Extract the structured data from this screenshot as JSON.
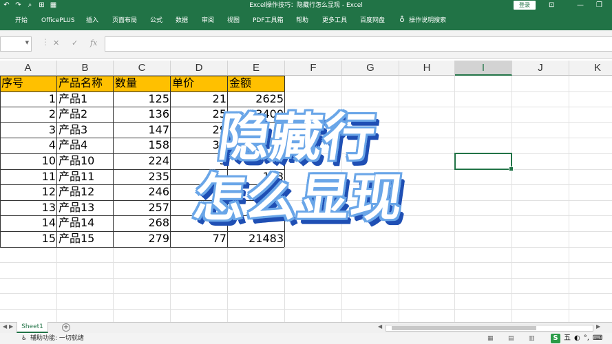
{
  "window": {
    "title": "Excel操作技巧：隐藏行怎么显现 - Excel",
    "login_label": "登录"
  },
  "qat": {
    "undo": "↶",
    "redo": "↷",
    "preview": "⌕",
    "grid": "⊞",
    "form": "▦"
  },
  "menu": [
    "开始",
    "OfficePLUS",
    "插入",
    "页面布局",
    "公式",
    "数据",
    "审阅",
    "视图",
    "PDF工具箱",
    "帮助",
    "更多工具",
    "百度网盘"
  ],
  "tell_me": "操作说明搜索",
  "formula_bar": {
    "name_box": "",
    "cancel": "✕",
    "enter": "✓",
    "fx": "fx",
    "formula": ""
  },
  "columns": [
    "A",
    "B",
    "C",
    "D",
    "E",
    "F",
    "G",
    "H",
    "I",
    "J",
    "K"
  ],
  "selected_column": "I",
  "table": {
    "header": [
      "序号",
      "产品名称",
      "数量",
      "单价",
      "金额"
    ],
    "rows": [
      [
        "1",
        "产品1",
        "125",
        "21",
        "2625"
      ],
      [
        "2",
        "产品2",
        "136",
        "25",
        "3400"
      ],
      [
        "3",
        "产品3",
        "147",
        "29",
        ""
      ],
      [
        "4",
        "产品4",
        "158",
        "33",
        ""
      ],
      [
        "10",
        "产品10",
        "224",
        "5",
        ""
      ],
      [
        "11",
        "产品11",
        "235",
        "",
        "143"
      ],
      [
        "12",
        "产品12",
        "246",
        "",
        "5"
      ],
      [
        "13",
        "产品13",
        "257",
        "",
        "1"
      ],
      [
        "14",
        "产品14",
        "268",
        "",
        ""
      ],
      [
        "15",
        "产品15",
        "279",
        "77",
        "21483"
      ]
    ]
  },
  "overlay": {
    "line1": "隐藏行",
    "line2": "怎么显现"
  },
  "sheets": [
    "Sheet1"
  ],
  "status": {
    "accessibility": "辅助功能: 一切就绪"
  },
  "ime": {
    "logo": "S",
    "items": [
      "五",
      "◐",
      "°,",
      "⌨"
    ]
  },
  "colors": {
    "brand": "#217346",
    "header_fill": "#ffc000",
    "overlay_outline": "#6aa6e8",
    "overlay_shadow": "#1f4fb4"
  }
}
